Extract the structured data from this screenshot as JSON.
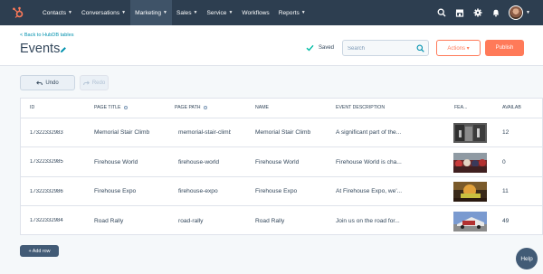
{
  "nav": {
    "items": [
      {
        "label": "Contacts",
        "active": false
      },
      {
        "label": "Conversations",
        "active": false
      },
      {
        "label": "Marketing",
        "active": true
      },
      {
        "label": "Sales",
        "active": false
      },
      {
        "label": "Service",
        "active": false
      },
      {
        "label": "Workflows",
        "active": false,
        "no_caret": true
      },
      {
        "label": "Reports",
        "active": false
      }
    ],
    "right_icons": [
      "search-icon",
      "marketplace-icon",
      "settings-icon",
      "notifications-icon"
    ]
  },
  "header": {
    "back_link": "< Back to HubDB tables",
    "title": "Events",
    "saved_label": "Saved",
    "search_placeholder": "Search",
    "actions_label": "Actions ▾",
    "publish_label": "Publish"
  },
  "toolbar": {
    "undo_label": "Undo",
    "redo_label": "Redo"
  },
  "table": {
    "columns": [
      "ID",
      "PAGE TITLE",
      "PAGE PATH",
      "NAME",
      "EVENT DESCRIPTION",
      "FEA...",
      "AVAILAB"
    ],
    "rows": [
      {
        "id": "17322332983",
        "page_title": "Memorial Stair Climb",
        "page_path": "memorial-stair-climb",
        "name": "Memorial Stair Climb",
        "description": "A significant part of the...",
        "available": "12",
        "thumb": "stairs"
      },
      {
        "id": "17322332985",
        "page_title": "Firehouse World",
        "page_path": "firehouse-world",
        "name": "Firehouse World",
        "description": "Firehouse World is cha...",
        "available": "0",
        "thumb": "crowd"
      },
      {
        "id": "17322332986",
        "page_title": "Firehouse Expo",
        "page_path": "firehouse-expo",
        "name": "Firehouse Expo",
        "description": "At Firehouse Expo, we'...",
        "available": "11",
        "thumb": "fire"
      },
      {
        "id": "17322332984",
        "page_title": "Road Rally",
        "page_path": "road-rally",
        "name": "Road Rally",
        "description": "Join us on the road for...",
        "available": "49",
        "thumb": "truck"
      }
    ]
  },
  "add_row_label": "+ Add row",
  "help_label": "Help",
  "colors": {
    "nav_bg": "#2d3e50",
    "accent": "#ff7a59",
    "link": "#0091ae",
    "saved_check": "#00bda5"
  }
}
